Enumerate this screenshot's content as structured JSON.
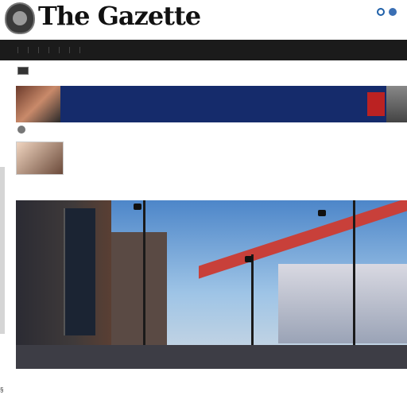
{
  "header": {
    "logo_text": "The Gazette",
    "logo_sub": "",
    "tools_label": "",
    "sub_links": []
  },
  "nav": {
    "items": []
  },
  "subnav": {
    "label_a": "",
    "label_b": ""
  },
  "banner": {
    "headline": "",
    "subline": ""
  },
  "article": {
    "byline": "",
    "title": "",
    "lines": [],
    "right_text": "",
    "caption": ""
  },
  "hero": {
    "caption": ""
  },
  "footer": {
    "lines": []
  },
  "colors": {
    "nav_bg": "#1b1b1b",
    "banner_bg": "#152b6b",
    "bridge_red": "#c8403a",
    "sky_top": "#4d86c9"
  },
  "icons": [
    "emblem-icon",
    "search-icon",
    "user-icon",
    "media-icon"
  ]
}
